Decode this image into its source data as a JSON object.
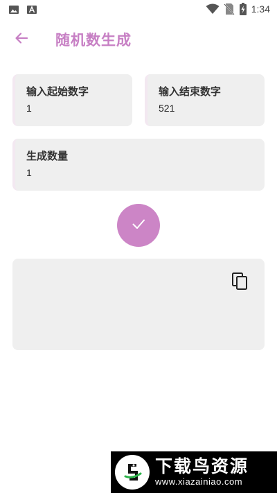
{
  "status_bar": {
    "time": "1:34",
    "left_icons": [
      "image-icon",
      "font-icon"
    ],
    "right_icons": [
      "wifi-icon",
      "no-sim-icon",
      "battery-charging-icon"
    ]
  },
  "app_bar": {
    "title": "随机数生成",
    "back_icon": "arrow-back-icon"
  },
  "form": {
    "start": {
      "label": "输入起始数字",
      "value": "1"
    },
    "end": {
      "label": "输入结束数字",
      "value": "521"
    },
    "count": {
      "label": "生成数量",
      "value": "1"
    }
  },
  "confirm_icon": "check-icon",
  "result": {
    "text": "",
    "copy_icon": "copy-icon"
  },
  "watermark": {
    "title": "下载鸟资源",
    "url": "www.xiazainiao.com"
  },
  "colors": {
    "accent": "#cc85c6",
    "title": "#c77fc4",
    "card_bg": "#efefef"
  }
}
